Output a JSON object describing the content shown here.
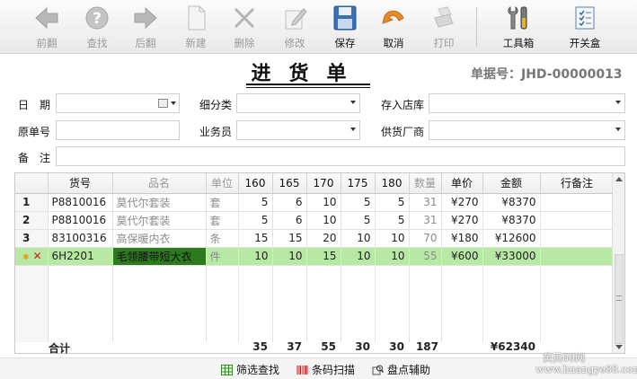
{
  "toolbar": {
    "buttons": [
      {
        "label": "前翻",
        "icon": "back-arrow-icon"
      },
      {
        "label": "查找",
        "icon": "help-question-icon"
      },
      {
        "label": "后翻",
        "icon": "forward-arrow-icon"
      },
      {
        "label": "新建",
        "icon": "new-document-icon"
      },
      {
        "label": "删除",
        "icon": "delete-x-icon"
      },
      {
        "label": "修改",
        "icon": "edit-pencil-icon"
      },
      {
        "label": "保存",
        "icon": "save-disk-icon"
      },
      {
        "label": "取消",
        "icon": "undo-arrow-icon"
      },
      {
        "label": "打印",
        "icon": "print-icon"
      },
      {
        "label": "工具箱",
        "icon": "toolbox-wrench-icon"
      },
      {
        "label": "开关盒",
        "icon": "checklist-icon"
      }
    ]
  },
  "header": {
    "title": "进货单",
    "doc_no": "单据号：JHD-00000013"
  },
  "form": {
    "date_label": "日　期",
    "subcategory_label": "细分类",
    "store_label": "存入店库",
    "orig_no_label": "原单号",
    "salesman_label": "业务员",
    "supplier_label": "供货厂商",
    "remark_label": "备　注"
  },
  "grid": {
    "columns": [
      "",
      "货号",
      "品名",
      "单位",
      "160",
      "165",
      "170",
      "175",
      "180",
      "数量",
      "单价",
      "金额",
      "行备注"
    ],
    "rows": [
      {
        "idx": "1",
        "code": "P8810016",
        "name": "莫代尔套装",
        "unit": "套",
        "s160": "5",
        "s165": "6",
        "s170": "10",
        "s175": "5",
        "s180": "5",
        "qty": "31",
        "price": "¥270",
        "amount": "¥8370",
        "note": ""
      },
      {
        "idx": "2",
        "code": "P8810016",
        "name": "莫代尔套装",
        "unit": "套",
        "s160": "5",
        "s165": "6",
        "s170": "10",
        "s175": "5",
        "s180": "5",
        "qty": "31",
        "price": "¥270",
        "amount": "¥8370",
        "note": ""
      },
      {
        "idx": "3",
        "code": "83100316",
        "name": "高保暖内衣",
        "unit": "条",
        "s160": "15",
        "s165": "15",
        "s170": "20",
        "s175": "10",
        "s180": "10",
        "qty": "70",
        "price": "¥180",
        "amount": "¥12600",
        "note": ""
      },
      {
        "idx": "✕",
        "code": "6H2201",
        "name": "毛领腰带短大衣",
        "unit": "件",
        "s160": "10",
        "s165": "10",
        "s170": "15",
        "s175": "10",
        "s180": "10",
        "qty": "55",
        "price": "¥600",
        "amount": "¥33000",
        "note": ""
      }
    ]
  },
  "totals": {
    "label": "合计",
    "s160": "35",
    "s165": "37",
    "s170": "55",
    "s175": "30",
    "s180": "30",
    "qty": "187",
    "amount": "¥62340"
  },
  "bottom": {
    "filter_label": "筛选查找",
    "barcode_label": "条码扫描",
    "inventory_label": "盘点辅助"
  },
  "watermark": {
    "line1": "黄页88网",
    "line2": "www.huangye88.com"
  },
  "colors": {
    "selected_row": "#b7e8a4",
    "selected_cell": "#2d7a1e",
    "save_blue": "#3a6fb8",
    "undo_orange": "#e88a2a"
  }
}
